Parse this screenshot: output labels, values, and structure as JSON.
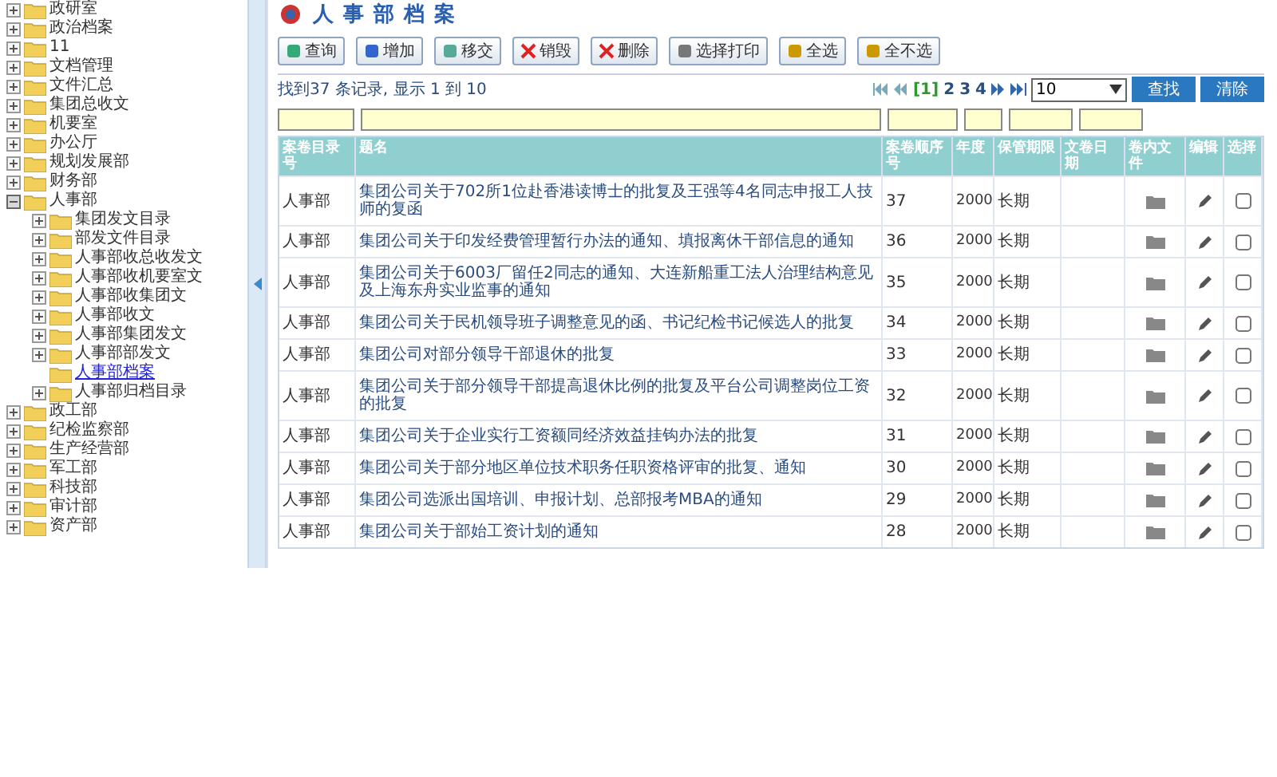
{
  "tree": [
    {
      "label": "政研室",
      "kind": "branch",
      "expanded": false,
      "selected": false
    },
    {
      "label": "政治档案",
      "kind": "branch",
      "expanded": false,
      "selected": false
    },
    {
      "label": "11",
      "kind": "branch",
      "expanded": false,
      "selected": false
    },
    {
      "label": "文档管理",
      "kind": "branch",
      "expanded": false,
      "selected": false
    },
    {
      "label": "文件汇总",
      "kind": "branch",
      "expanded": false,
      "selected": false
    },
    {
      "label": "集团总收文",
      "kind": "branch",
      "expanded": false,
      "selected": false
    },
    {
      "label": "机要室",
      "kind": "branch",
      "expanded": false,
      "selected": false
    },
    {
      "label": "办公厅",
      "kind": "branch",
      "expanded": false,
      "selected": false
    },
    {
      "label": "规划发展部",
      "kind": "branch",
      "expanded": false,
      "selected": false
    },
    {
      "label": "财务部",
      "kind": "branch",
      "expanded": false,
      "selected": false
    },
    {
      "label": "人事部",
      "kind": "branch",
      "expanded": true,
      "selected": false,
      "children": [
        {
          "label": "集团发文目录",
          "kind": "branch",
          "expanded": false,
          "selected": false
        },
        {
          "label": "部发文件目录",
          "kind": "branch",
          "expanded": false,
          "selected": false
        },
        {
          "label": "人事部收总收发文",
          "kind": "branch",
          "expanded": false,
          "selected": false
        },
        {
          "label": "人事部收机要室文",
          "kind": "branch",
          "expanded": false,
          "selected": false
        },
        {
          "label": "人事部收集团文",
          "kind": "branch",
          "expanded": false,
          "selected": false
        },
        {
          "label": "人事部收文",
          "kind": "branch",
          "expanded": false,
          "selected": false
        },
        {
          "label": "人事部集团发文",
          "kind": "branch",
          "expanded": false,
          "selected": false
        },
        {
          "label": "人事部部发文",
          "kind": "branch",
          "expanded": false,
          "selected": false
        },
        {
          "label": "人事部档案",
          "kind": "leaf",
          "selected": true
        },
        {
          "label": "人事部归档目录",
          "kind": "branch",
          "expanded": false,
          "selected": false
        }
      ]
    },
    {
      "label": "政工部",
      "kind": "branch",
      "expanded": false,
      "selected": false
    },
    {
      "label": "纪检监察部",
      "kind": "branch",
      "expanded": false,
      "selected": false
    },
    {
      "label": "生产经营部",
      "kind": "branch",
      "expanded": false,
      "selected": false
    },
    {
      "label": "军工部",
      "kind": "branch",
      "expanded": false,
      "selected": false
    },
    {
      "label": "科技部",
      "kind": "branch",
      "expanded": false,
      "selected": false
    },
    {
      "label": "审计部",
      "kind": "branch",
      "expanded": false,
      "selected": false
    },
    {
      "label": "资产部",
      "kind": "branch",
      "expanded": false,
      "selected": false
    }
  ],
  "page_title": "人事部档案",
  "toolbar": [
    {
      "label": "查询",
      "kind": "search"
    },
    {
      "label": "增加",
      "kind": "add"
    },
    {
      "label": "移交",
      "kind": "transfer"
    },
    {
      "label": "销毁",
      "kind": "delete"
    },
    {
      "label": "删除",
      "kind": "delete"
    },
    {
      "label": "选择打印",
      "kind": "print"
    },
    {
      "label": "全选",
      "kind": "select"
    },
    {
      "label": "全不选",
      "kind": "select"
    }
  ],
  "summary": "找到37 条记录, 显示 1 到 10",
  "pager": {
    "pages": [
      {
        "label": "[1]",
        "selected": true
      },
      {
        "label": "2",
        "selected": false
      },
      {
        "label": "3",
        "selected": false
      },
      {
        "label": "4",
        "selected": false
      }
    ],
    "page_size": "10",
    "find_button": "查找",
    "clear_button": "清除"
  },
  "table": {
    "columns": [
      "案卷目录号",
      "题名",
      "案卷顺序号",
      "年度",
      "保管期限",
      "文卷日期",
      "卷内文件",
      "编辑",
      "选择"
    ],
    "rows": [
      {
        "dept": "人事部",
        "title": "集团公司关于702所1位赴香港读博士的批复及王强等4名同志申报工人技师的复函",
        "no": "37",
        "year": "2000",
        "term": "长期",
        "checked": false
      },
      {
        "dept": "人事部",
        "title": "集团公司关于印发经费管理暂行办法的通知、填报离休干部信息的通知",
        "no": "36",
        "year": "2000",
        "term": "长期",
        "checked": false
      },
      {
        "dept": "人事部",
        "title": "集团公司关于6003厂留任2同志的通知、大连新船重工法人治理结构意见及上海东舟实业监事的通知",
        "no": "35",
        "year": "2000",
        "term": "长期",
        "checked": false
      },
      {
        "dept": "人事部",
        "title": "集团公司关于民机领导班子调整意见的函、书记纪检书记候选人的批复",
        "no": "34",
        "year": "2000",
        "term": "长期",
        "checked": false
      },
      {
        "dept": "人事部",
        "title": "集团公司对部分领导干部退休的批复",
        "no": "33",
        "year": "2000",
        "term": "长期",
        "checked": false
      },
      {
        "dept": "人事部",
        "title": "集团公司关于部分领导干部提高退休比例的批复及平台公司调整岗位工资的批复",
        "no": "32",
        "year": "2000",
        "term": "长期",
        "checked": false
      },
      {
        "dept": "人事部",
        "title": "集团公司关于企业实行工资额同经济效益挂钩办法的批复",
        "no": "31",
        "year": "2000",
        "term": "长期",
        "checked": false
      },
      {
        "dept": "人事部",
        "title": "集团公司关于部分地区单位技术职务任职资格评审的批复、通知",
        "no": "30",
        "year": "2000",
        "term": "长期",
        "checked": false
      },
      {
        "dept": "人事部",
        "title": "集团公司选派出国培训、申报计划、总部报考MBA的通知",
        "no": "29",
        "year": "2000",
        "term": "长期",
        "checked": false
      },
      {
        "dept": "人事部",
        "title": "集团公司关于部始工资计划的通知",
        "no": "28",
        "year": "2000",
        "term": "长期",
        "checked": false
      }
    ]
  }
}
